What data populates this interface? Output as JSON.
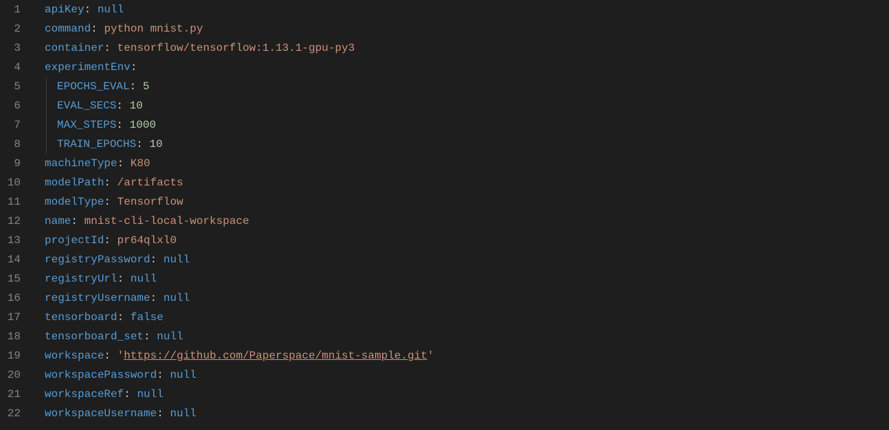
{
  "lines": [
    {
      "num": "1",
      "indent": 0,
      "key": "apiKey",
      "value": "null",
      "valueType": "null"
    },
    {
      "num": "2",
      "indent": 0,
      "key": "command",
      "value": "python mnist.py",
      "valueType": "string"
    },
    {
      "num": "3",
      "indent": 0,
      "key": "container",
      "value": "tensorflow/tensorflow:1.13.1-gpu-py3",
      "valueType": "string"
    },
    {
      "num": "4",
      "indent": 0,
      "key": "experimentEnv",
      "value": "",
      "valueType": "none"
    },
    {
      "num": "5",
      "indent": 1,
      "key": "EPOCHS_EVAL",
      "value": "5",
      "valueType": "number"
    },
    {
      "num": "6",
      "indent": 1,
      "key": "EVAL_SECS",
      "value": "10",
      "valueType": "number"
    },
    {
      "num": "7",
      "indent": 1,
      "key": "MAX_STEPS",
      "value": "1000",
      "valueType": "number"
    },
    {
      "num": "8",
      "indent": 1,
      "key": "TRAIN_EPOCHS",
      "value": "10",
      "valueType": "number"
    },
    {
      "num": "9",
      "indent": 0,
      "key": "machineType",
      "value": "K80",
      "valueType": "string"
    },
    {
      "num": "10",
      "indent": 0,
      "key": "modelPath",
      "value": "/artifacts",
      "valueType": "string"
    },
    {
      "num": "11",
      "indent": 0,
      "key": "modelType",
      "value": "Tensorflow",
      "valueType": "string"
    },
    {
      "num": "12",
      "indent": 0,
      "key": "name",
      "value": "mnist-cli-local-workspace",
      "valueType": "string"
    },
    {
      "num": "13",
      "indent": 0,
      "key": "projectId",
      "value": "pr64qlxl0",
      "valueType": "string"
    },
    {
      "num": "14",
      "indent": 0,
      "key": "registryPassword",
      "value": "null",
      "valueType": "null"
    },
    {
      "num": "15",
      "indent": 0,
      "key": "registryUrl",
      "value": "null",
      "valueType": "null"
    },
    {
      "num": "16",
      "indent": 0,
      "key": "registryUsername",
      "value": "null",
      "valueType": "null"
    },
    {
      "num": "17",
      "indent": 0,
      "key": "tensorboard",
      "value": "false",
      "valueType": "bool"
    },
    {
      "num": "18",
      "indent": 0,
      "key": "tensorboard_set",
      "value": "null",
      "valueType": "null"
    },
    {
      "num": "19",
      "indent": 0,
      "key": "workspace",
      "value": "https://github.com/Paperspace/mnist-sample.git",
      "valueType": "quotedlink"
    },
    {
      "num": "20",
      "indent": 0,
      "key": "workspacePassword",
      "value": "null",
      "valueType": "null"
    },
    {
      "num": "21",
      "indent": 0,
      "key": "workspaceRef",
      "value": "null",
      "valueType": "null"
    },
    {
      "num": "22",
      "indent": 0,
      "key": "workspaceUsername",
      "value": "null",
      "valueType": "null"
    }
  ]
}
